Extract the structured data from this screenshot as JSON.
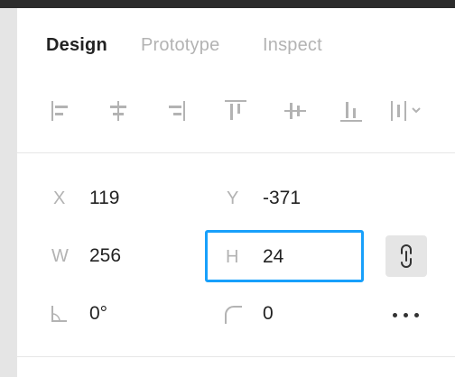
{
  "tabs": [
    {
      "label": "Design",
      "active": true
    },
    {
      "label": "Prototype",
      "active": false
    },
    {
      "label": "Inspect",
      "active": false
    }
  ],
  "align_tools": [
    {
      "name": "align-left-icon"
    },
    {
      "name": "align-horizontal-center-icon"
    },
    {
      "name": "align-right-icon"
    },
    {
      "name": "align-top-icon"
    },
    {
      "name": "align-vertical-center-icon"
    },
    {
      "name": "align-bottom-icon"
    },
    {
      "name": "distribute-dropdown-icon"
    }
  ],
  "properties": {
    "x": {
      "label": "X",
      "value": "119"
    },
    "y": {
      "label": "Y",
      "value": "-371"
    },
    "w": {
      "label": "W",
      "value": "256"
    },
    "h": {
      "label": "H",
      "value": "24"
    },
    "rotation": {
      "icon": "rotation-angle-icon",
      "value": "0°"
    },
    "corner_radius": {
      "icon": "corner-radius-icon",
      "value": "0"
    }
  },
  "colors": {
    "focus_border": "#18a0fb",
    "active_tab": "#222222",
    "inactive_tab": "#b3b3b3",
    "icon": "#b3b3b3"
  }
}
